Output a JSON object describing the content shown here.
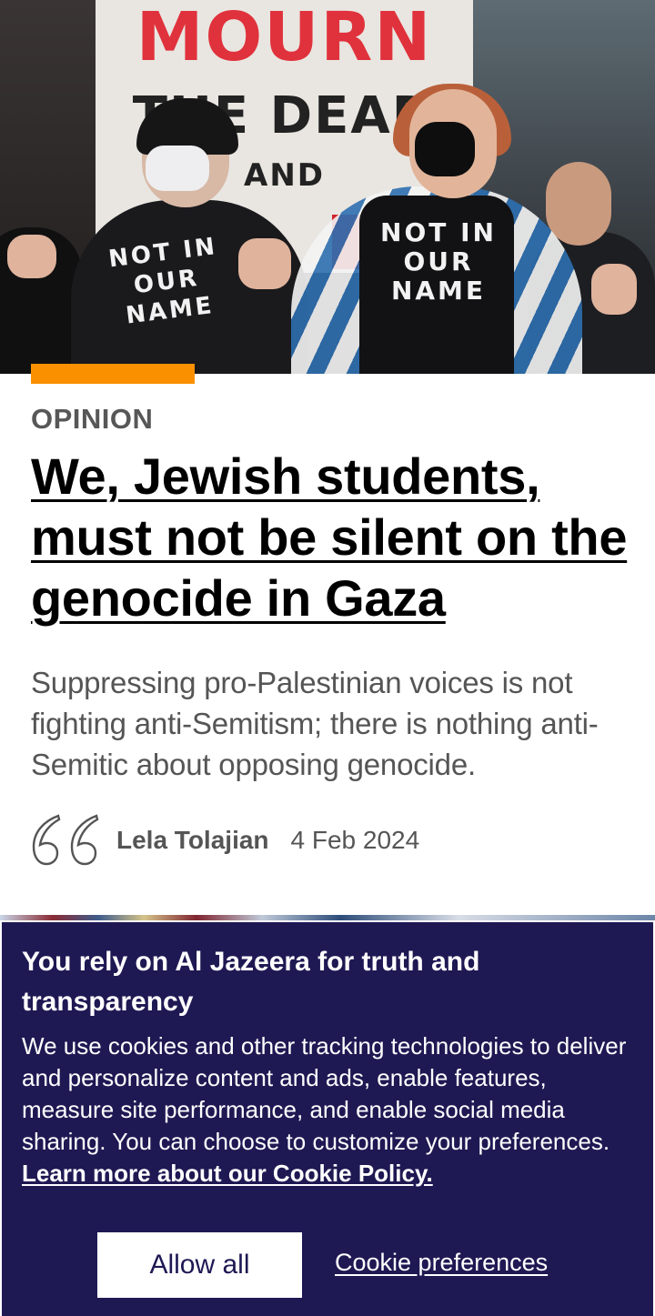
{
  "hero_image": {
    "banner_text": [
      "MOURN",
      "THE DEAD",
      "AND"
    ],
    "shirt_text_left": [
      "NOT IN",
      "OUR",
      "NAME"
    ],
    "shirt_text_right": [
      "NOT IN",
      "OUR",
      "NAME"
    ]
  },
  "article": {
    "category": "OPINION",
    "headline": "We, Jewish students, must not be silent on the genocide in Gaza",
    "standfirst": "Suppressing pro-Palestinian voices is not fighting anti-Semitism; there is nothing anti-Semitic about opposing genocide.",
    "author": "Lela Tolajian",
    "date": "4 Feb 2024",
    "accent_color": "#fa9000"
  },
  "cookie_banner": {
    "title": "You rely on Al Jazeera for truth and transparency",
    "body": "We use cookies and other tracking technologies to deliver and personalize content and ads, enable features, measure site performance, and enable social media sharing. You can choose to customize your preferences.",
    "link_label": "Learn more about our Cookie Policy.",
    "allow_all_label": "Allow all",
    "preferences_label": "Cookie preferences",
    "background_color": "#1e1953"
  },
  "icons": {
    "quote": "opinion-quote-icon"
  }
}
